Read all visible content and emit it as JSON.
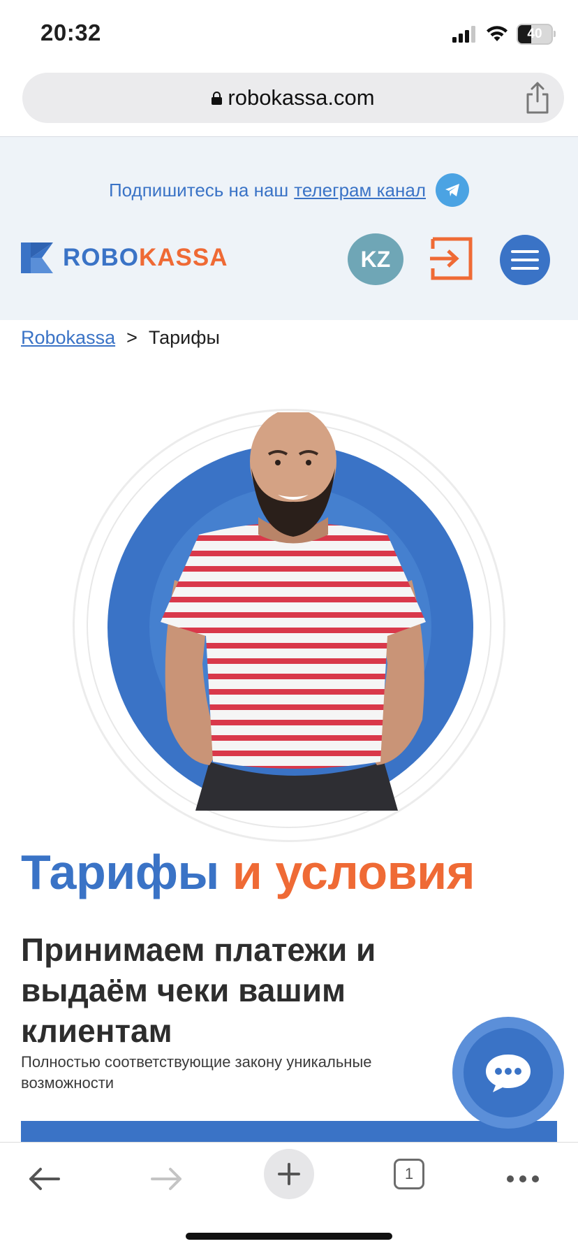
{
  "status_bar": {
    "time": "20:32",
    "battery": "40"
  },
  "browser": {
    "url": "robokassa.com",
    "tabs_count": "1"
  },
  "promo": {
    "text": "Подпишитесь на наш",
    "link": "телеграм канал"
  },
  "header": {
    "logo_part1": "ROBO",
    "logo_part2": "KASSA",
    "region": "KZ"
  },
  "breadcrumb": {
    "home": "Robokassa",
    "separator": ">",
    "current": "Тарифы"
  },
  "main": {
    "title_part1": "Тарифы",
    "title_part2": "и условия",
    "subtitle": "Принимаем платежи и выдаём чеки вашим клиентам",
    "description": "Полностью соответствующие закону уникальные возможности"
  },
  "colors": {
    "brand_blue": "#3a73c6",
    "brand_orange": "#ef6a35",
    "header_bg": "#eef3f8",
    "telegram": "#4ba3e3"
  },
  "icons": [
    "lock-icon",
    "share-icon",
    "telegram-icon",
    "login-icon",
    "menu-icon",
    "chat-icon",
    "back-icon",
    "forward-icon",
    "plus-icon",
    "more-icon"
  ]
}
